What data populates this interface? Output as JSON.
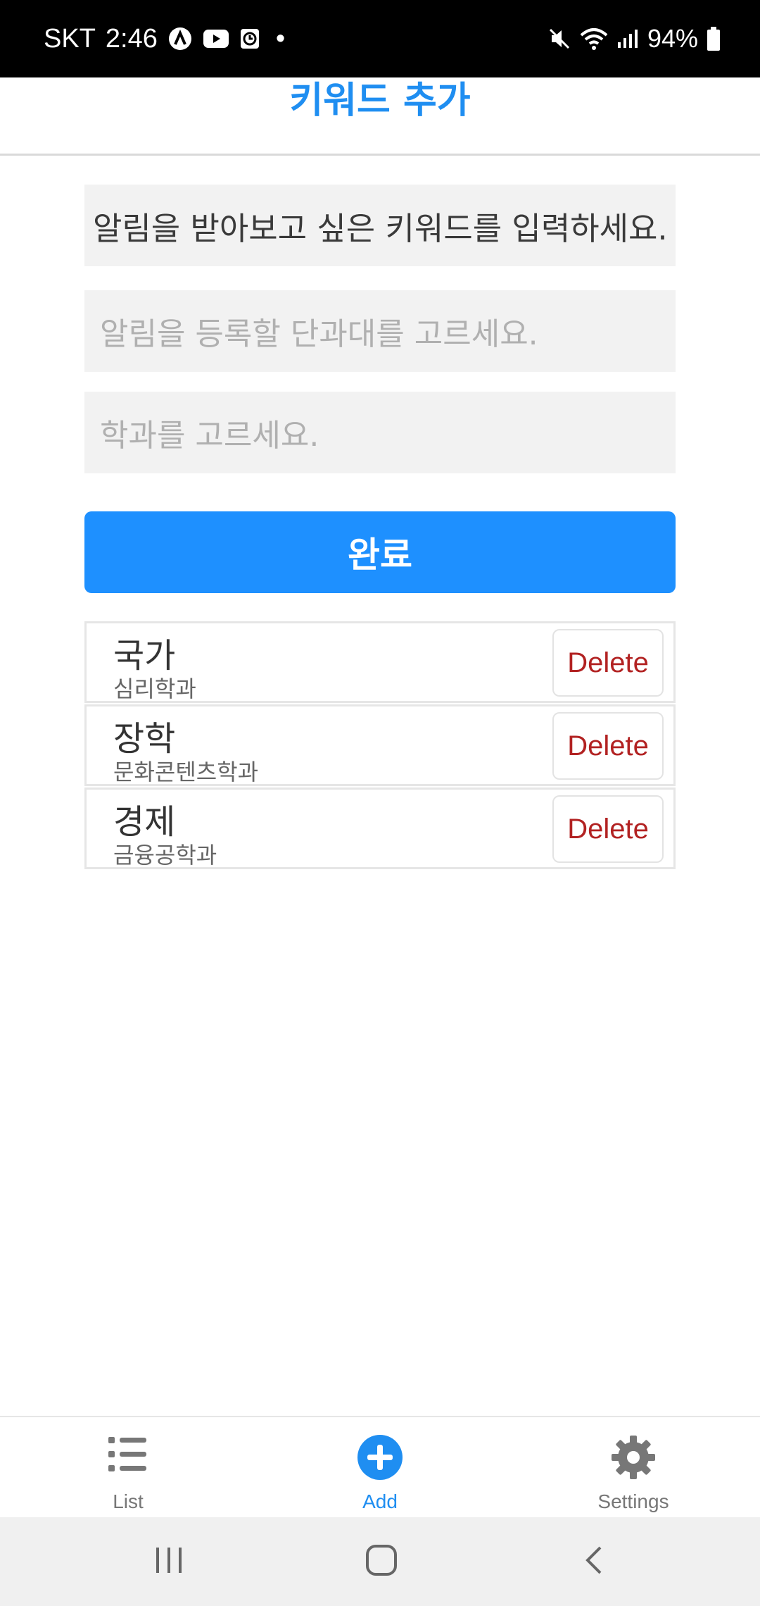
{
  "status_bar": {
    "carrier": "SKT",
    "time": "2:46",
    "dot": "•",
    "battery": "94%",
    "icons": [
      "app-a-icon",
      "youtube-icon",
      "clock-app-icon",
      "mute-icon",
      "wifi-icon",
      "signal-icon",
      "battery-icon"
    ]
  },
  "header": {
    "title": "키워드 추가"
  },
  "form": {
    "keyword_value": "알림을 받아보고 싶은 키워드를 입력하세요.",
    "college_placeholder": "알림을 등록할 단과대를 고르세요.",
    "department_placeholder": "학과를 고르세요.",
    "submit_label": "완료"
  },
  "keywords": [
    {
      "keyword": "국가",
      "department": "심리학과",
      "delete_label": "Delete"
    },
    {
      "keyword": "장학",
      "department": "문화콘텐츠학과",
      "delete_label": "Delete"
    },
    {
      "keyword": "경제",
      "department": "금융공학과",
      "delete_label": "Delete"
    }
  ],
  "tabs": [
    {
      "label": "List",
      "icon": "list-icon"
    },
    {
      "label": "Add",
      "icon": "add-circle-icon",
      "active": true
    },
    {
      "label": "Settings",
      "icon": "gear-icon"
    }
  ],
  "nav": [
    "recent-apps-icon",
    "home-icon",
    "back-icon"
  ],
  "colors": {
    "accent": "#1f8ef1",
    "button": "#1e90ff",
    "delete_text": "#b22222",
    "input_bg": "#f2f2f2",
    "placeholder": "#b0b0b0"
  }
}
